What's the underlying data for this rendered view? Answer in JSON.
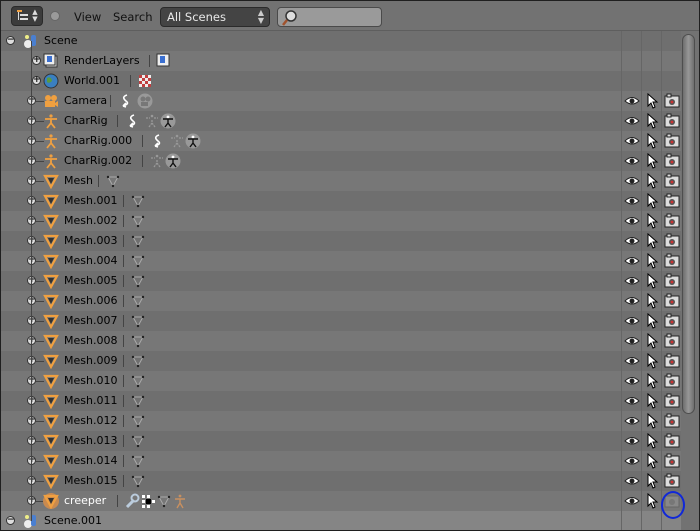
{
  "header": {
    "editor_type_icon": "outliner-icon",
    "view_menu": "View",
    "search_menu": "Search",
    "display_mode": "All Scenes",
    "search_placeholder": ""
  },
  "tree": [
    {
      "name": "Scene",
      "level": 0,
      "type": "scene",
      "expanded": true,
      "subicons": []
    },
    {
      "name": "RenderLayers",
      "level": 1,
      "type": "renderlayers",
      "subicons": [
        "renderlayer"
      ]
    },
    {
      "name": "World.001",
      "level": 1,
      "type": "world",
      "subicons": [
        "texture"
      ]
    },
    {
      "name": "Camera",
      "level": 2,
      "type": "camera",
      "subicons": [
        "constraint",
        "camera-data"
      ],
      "restrict": true
    },
    {
      "name": "CharRig",
      "level": 2,
      "type": "armature",
      "subicons": [
        "constraint",
        "bones",
        "armature-data"
      ],
      "restrict": true
    },
    {
      "name": "CharRig.000",
      "level": 2,
      "type": "armature",
      "subicons": [
        "constraint",
        "bones",
        "armature-data"
      ],
      "restrict": true
    },
    {
      "name": "CharRig.002",
      "level": 2,
      "type": "armature",
      "subicons": [
        "bones",
        "armature-data"
      ],
      "restrict": true
    },
    {
      "name": "Mesh",
      "level": 2,
      "type": "mesh",
      "subicons": [
        "mesh-data"
      ],
      "restrict": true
    },
    {
      "name": "Mesh.001",
      "level": 2,
      "type": "mesh",
      "subicons": [
        "mesh-data"
      ],
      "restrict": true
    },
    {
      "name": "Mesh.002",
      "level": 2,
      "type": "mesh",
      "subicons": [
        "mesh-data"
      ],
      "restrict": true
    },
    {
      "name": "Mesh.003",
      "level": 2,
      "type": "mesh",
      "subicons": [
        "mesh-data"
      ],
      "restrict": true
    },
    {
      "name": "Mesh.004",
      "level": 2,
      "type": "mesh",
      "subicons": [
        "mesh-data"
      ],
      "restrict": true
    },
    {
      "name": "Mesh.005",
      "level": 2,
      "type": "mesh",
      "subicons": [
        "mesh-data"
      ],
      "restrict": true
    },
    {
      "name": "Mesh.006",
      "level": 2,
      "type": "mesh",
      "subicons": [
        "mesh-data"
      ],
      "restrict": true
    },
    {
      "name": "Mesh.007",
      "level": 2,
      "type": "mesh",
      "subicons": [
        "mesh-data"
      ],
      "restrict": true
    },
    {
      "name": "Mesh.008",
      "level": 2,
      "type": "mesh",
      "subicons": [
        "mesh-data"
      ],
      "restrict": true
    },
    {
      "name": "Mesh.009",
      "level": 2,
      "type": "mesh",
      "subicons": [
        "mesh-data"
      ],
      "restrict": true
    },
    {
      "name": "Mesh.010",
      "level": 2,
      "type": "mesh",
      "subicons": [
        "mesh-data"
      ],
      "restrict": true
    },
    {
      "name": "Mesh.011",
      "level": 2,
      "type": "mesh",
      "subicons": [
        "mesh-data"
      ],
      "restrict": true
    },
    {
      "name": "Mesh.012",
      "level": 2,
      "type": "mesh",
      "subicons": [
        "mesh-data"
      ],
      "restrict": true
    },
    {
      "name": "Mesh.013",
      "level": 2,
      "type": "mesh",
      "subicons": [
        "mesh-data"
      ],
      "restrict": true
    },
    {
      "name": "Mesh.014",
      "level": 2,
      "type": "mesh",
      "subicons": [
        "mesh-data"
      ],
      "restrict": true
    },
    {
      "name": "Mesh.015",
      "level": 2,
      "type": "mesh",
      "subicons": [
        "mesh-data"
      ],
      "restrict": true
    },
    {
      "name": "creeper",
      "level": 2,
      "type": "mesh",
      "active": true,
      "subicons": [
        "modifier",
        "vertex-groups",
        "mesh-data",
        "armature-bone"
      ],
      "restrict": true,
      "render_disabled": true
    },
    {
      "name": "Scene.001",
      "level": 0,
      "type": "scene",
      "expanded": true,
      "selected": true,
      "subicons": []
    }
  ],
  "colors": {
    "annotation": "#1028d8",
    "object_orange": "#f0a040"
  }
}
